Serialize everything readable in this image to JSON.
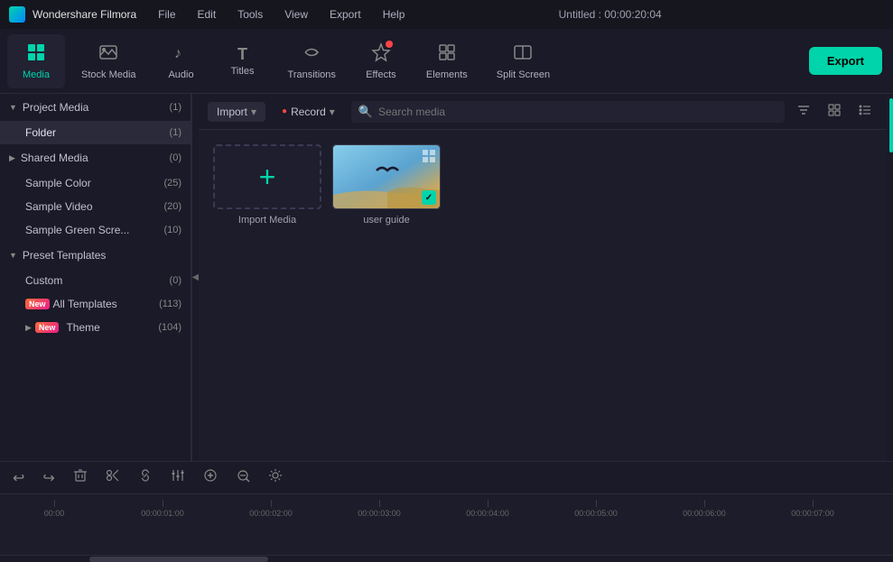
{
  "titleBar": {
    "appName": "Wondershare Filmora",
    "menus": [
      "File",
      "Edit",
      "Tools",
      "View",
      "Export",
      "Help"
    ],
    "title": "Untitled : 00:00:20:04"
  },
  "toolbar": {
    "tools": [
      {
        "id": "media",
        "label": "Media",
        "icon": "▦",
        "active": true,
        "badge": false
      },
      {
        "id": "stock-media",
        "label": "Stock Media",
        "icon": "🖼",
        "active": false,
        "badge": false
      },
      {
        "id": "audio",
        "label": "Audio",
        "icon": "♪",
        "active": false,
        "badge": false
      },
      {
        "id": "titles",
        "label": "Titles",
        "icon": "T",
        "active": false,
        "badge": false
      },
      {
        "id": "transitions",
        "label": "Transitions",
        "icon": "⇄",
        "active": false,
        "badge": false
      },
      {
        "id": "effects",
        "label": "Effects",
        "icon": "✦",
        "active": false,
        "badge": true
      },
      {
        "id": "elements",
        "label": "Elements",
        "icon": "◈",
        "active": false,
        "badge": false
      },
      {
        "id": "split-screen",
        "label": "Split Screen",
        "icon": "⊞",
        "active": false,
        "badge": false
      }
    ],
    "exportLabel": "Export"
  },
  "sidebar": {
    "sections": [
      {
        "id": "project-media",
        "label": "Project Media",
        "count": "(1)",
        "expanded": true,
        "items": [
          {
            "id": "folder",
            "label": "Folder",
            "count": "(1)",
            "active": true,
            "indent": 1
          }
        ]
      },
      {
        "id": "shared-media",
        "label": "Shared Media",
        "count": "(0)",
        "expanded": false,
        "items": [
          {
            "id": "sample-color",
            "label": "Sample Color",
            "count": "(25)",
            "active": false
          },
          {
            "id": "sample-video",
            "label": "Sample Video",
            "count": "(20)",
            "active": false
          },
          {
            "id": "sample-green",
            "label": "Sample Green Scre...",
            "count": "(10)",
            "active": false
          }
        ]
      },
      {
        "id": "preset-templates",
        "label": "Preset Templates",
        "count": "",
        "expanded": true,
        "items": [
          {
            "id": "custom",
            "label": "Custom",
            "count": "(0)",
            "active": false,
            "new": false
          },
          {
            "id": "all-templates",
            "label": "All Templates",
            "count": "(113)",
            "active": false,
            "new": true
          },
          {
            "id": "theme",
            "label": "Theme",
            "count": "(104)",
            "active": false,
            "new": true,
            "hasChevron": true
          }
        ]
      }
    ]
  },
  "mediaToolbar": {
    "importLabel": "Import",
    "recordLabel": "Record",
    "searchPlaceholder": "Search media"
  },
  "mediaGrid": {
    "items": [
      {
        "id": "import-media",
        "label": "Import Media",
        "type": "import"
      },
      {
        "id": "user-guide",
        "label": "user guide",
        "type": "video"
      }
    ]
  },
  "timeline": {
    "buttons": [
      "↩",
      "↪",
      "🗑",
      "✂",
      "🔗",
      "🎚",
      "⊕",
      "◎",
      "↺"
    ],
    "markers": [
      "00:00",
      "00:00:01:00",
      "00:00:02:00",
      "00:00:03:00",
      "00:00:04:00",
      "00:00:05:00",
      "00:00:06:00",
      "00:00:07:00"
    ]
  }
}
